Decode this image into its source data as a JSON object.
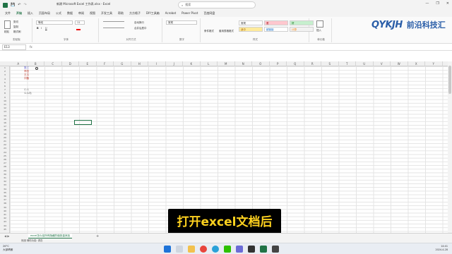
{
  "window": {
    "title": "新建 Microsoft Excel 工作表.xlsx - Excel",
    "search_placeholder": "搜索"
  },
  "quick_access": {
    "autosave": "自动保存",
    "icons": [
      "save-icon",
      "undo-icon",
      "redo-icon"
    ]
  },
  "tabs": [
    "文件",
    "开始",
    "插入",
    "页面布局",
    "公式",
    "数据",
    "审阅",
    "视图",
    "开发工具",
    "帮助",
    "方方格子",
    "DIY工具箱",
    "Acrobat",
    "Power Pivot",
    "百度网盘"
  ],
  "active_tab": "开始",
  "ribbon": {
    "clipboard": {
      "paste": "粘贴",
      "cut": "剪切",
      "copy": "复制",
      "format_painter": "格式刷",
      "label": "剪贴板"
    },
    "font": {
      "name": "等线",
      "size": "11",
      "label": "字体",
      "bold": "B",
      "italic": "I",
      "underline": "U"
    },
    "alignment": {
      "wrap": "自动换行",
      "merge": "合并后居中",
      "label": "对齐方式"
    },
    "number": {
      "format": "常规",
      "label": "数字"
    },
    "styles": {
      "conditional": "条件格式",
      "table": "套用表格格式",
      "cells": [
        {
          "text": "常规",
          "bg": "#ffffff",
          "color": "#333333"
        },
        {
          "text": "差",
          "bg": "#ffc7ce",
          "color": "#9c0006"
        },
        {
          "text": "好",
          "bg": "#c6efce",
          "color": "#006100"
        },
        {
          "text": "适中",
          "bg": "#ffeb9c",
          "color": "#9c5700"
        },
        {
          "text": "超链接",
          "bg": "#ffffff",
          "color": "#0563c1"
        },
        {
          "text": "计算",
          "bg": "#f2f2f2",
          "color": "#fa7d00"
        }
      ],
      "label": "样式"
    },
    "cells_group": {
      "insert": "插入",
      "label": "单元格"
    }
  },
  "logo": {
    "mark": "QYKJH",
    "name": "前沿科技汇",
    "color": "#2a5ea8"
  },
  "formula_bar": {
    "name_box": "E13",
    "fx": "fx"
  },
  "columns": [
    "A",
    "B",
    "C",
    "D",
    "E",
    "F",
    "G",
    "H",
    "I",
    "J",
    "K",
    "L",
    "M",
    "N",
    "O",
    "P",
    "Q",
    "R",
    "S",
    "T",
    "U",
    "V",
    "W",
    "X",
    "Y",
    "Z"
  ],
  "rows": [
    "1",
    "2",
    "3",
    "4",
    "5",
    "6",
    "7",
    "8",
    "9",
    "10",
    "11",
    "12",
    "13",
    "14",
    "15",
    "16",
    "17",
    "18",
    "19",
    "20",
    "21",
    "22",
    "23",
    "24",
    "25",
    "26",
    "27",
    "28",
    "29",
    "30",
    "31",
    "32",
    "33",
    "34",
    "35",
    "36",
    "37",
    "38",
    "39",
    "40",
    "41",
    "42",
    "43",
    "44",
    "45"
  ],
  "cells": {
    "b1": "张三",
    "b2": "李四",
    "b3": "王五",
    "b4": "刘备",
    "b7": "小人",
    "b8": "么么哒"
  },
  "sheet": {
    "name": "excel怎么给所有隐藏的值批量添加",
    "add": "+"
  },
  "status": {
    "text": "就绪  辅助功能: 调查"
  },
  "taskbar": {
    "weather_temp": "26°C",
    "weather_desc": "大部晴朗",
    "time": "14:41",
    "date": "2024-4-28"
  },
  "caption": {
    "text": "打开excel文档后",
    "color": "#ffd21f"
  }
}
